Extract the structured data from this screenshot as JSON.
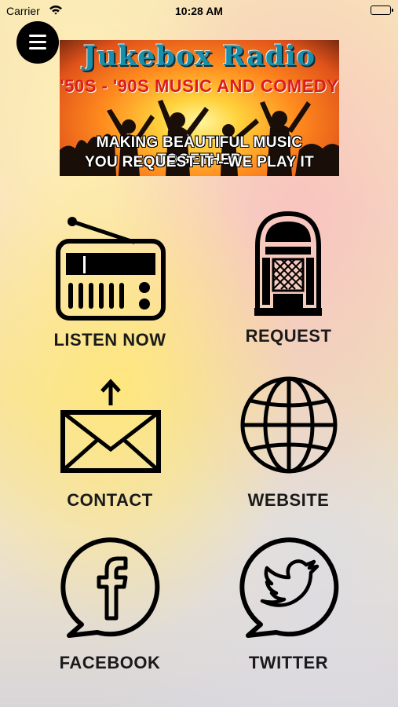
{
  "status_bar": {
    "carrier": "Carrier",
    "time": "10:28 AM"
  },
  "banner": {
    "title": "Jukebox Radio",
    "subtitle": "'50S - '90S MUSIC AND COMEDY",
    "tagline_line1": "MAKING BEAUTIFUL MUSIC TOGETHER",
    "tagline_line2": "YOU REQUEST IT - WE PLAY IT"
  },
  "grid": {
    "listen_now": "LISTEN NOW",
    "request": "REQUEST",
    "contact": "CONTACT",
    "website": "WEBSITE",
    "facebook": "FACEBOOK",
    "twitter": "TWITTER"
  }
}
